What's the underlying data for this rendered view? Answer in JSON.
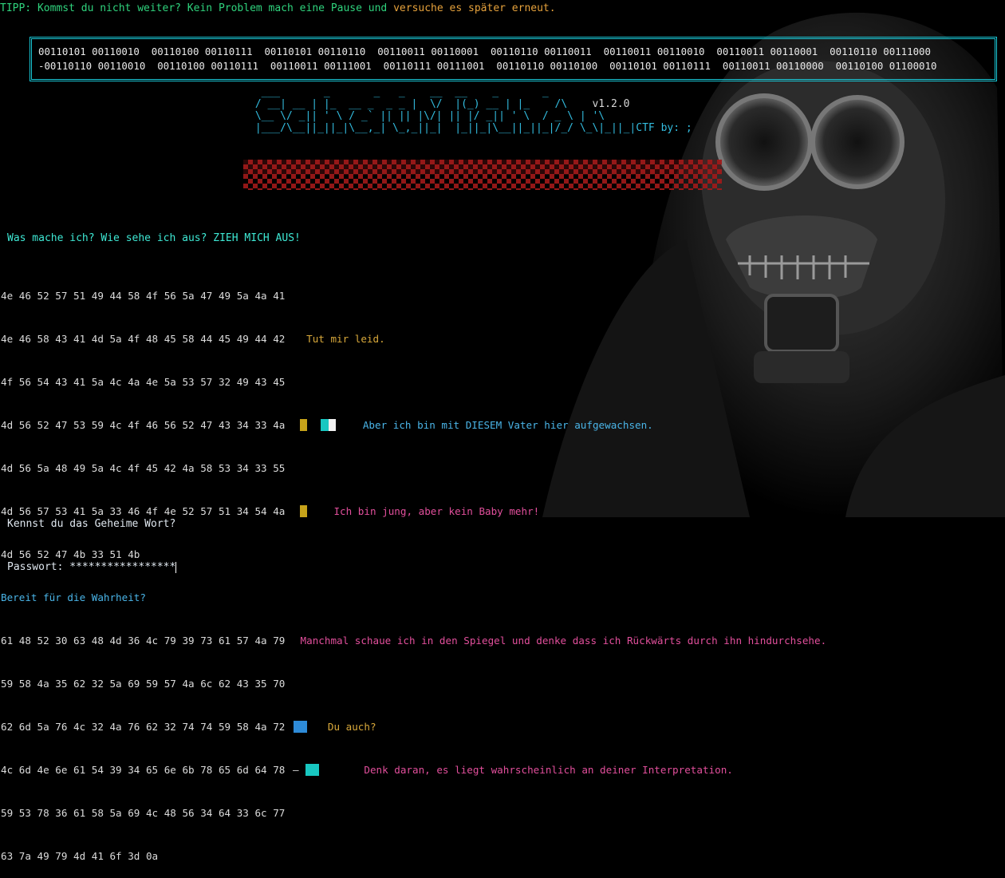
{
  "tip": {
    "label": "TIPP:",
    "part1": " Kommst du nicht weiter? Kein Problem mach eine Pause und ",
    "part2": "versuche es später erneut."
  },
  "binary": {
    "line1": "00110101 00110010  00110100 00110111  00110101 00110110  00110011 00110001  00110110 00110011  00110011 00110010  00110011 00110001  00110110 00111000",
    "line2": "-00110110 00110010  00110100 00110111  00110011 00111001  00110111 00111001  00110110 00110100  00110101 00110111  00110011 00110000  00110100 01100010"
  },
  "banner": {
    "line1": "  ___       _       _   _    __  __    _       _  ",
    "line2": " / __| __ | |_  __ _  _ _ |  \\/  |(_) __ | |_    /\\    ",
    "line3": " \\__ \\/ _|| ' \\ / _` || || |\\/| || |/ _|| ' \\  / _ \\ | '\\",
    "line4": " |___/\\__||_||_|\\__,_| \\_,_||_|  |_||_|\\__||_||_|/_/ \\_\\|_||_|",
    "version": "v1.2.0",
    "ctf": "CTF by: ;"
  },
  "question": "Was mache ich? Wie sehe ich aus? ZIEH MICH AUS!",
  "hexlines": [
    "4e 46 52 57 51 49 44 58 4f 56 5a 47 49 5a 4a 41",
    "4e 46 58 43 41 4d 5a 4f 48 45 58 44 45 49 44 42",
    "4f 56 54 43 41 5a 4c 4a 4e 5a 53 57 32 49 43 45",
    "4d 56 52 47 53 59 4c 4f 46 56 52 47 43 34 33 4a",
    "4d 56 5a 48 49 5a 4c 4f 45 42 4a 58 53 34 33 55",
    "4d 56 57 53 41 5a 33 46 4f 4e 52 57 51 34 54 4a",
    "4d 56 52 47 4b 33 51 4b",
    "61 48 52 30 63 48 4d 36 4c 79 39 73 61 57 4a 79",
    "59 58 4a 35 62 32 5a 69 59 57 4a 6c 62 43 35 70",
    "62 6d 5a 76 4c 32 4a 76 62 32 74 74 59 58 4a 72",
    "4c 6d 4e 6e 61 54 39 34 65 6e 6b 78 65 6d 64 78",
    "59 53 78 36 61 58 5a 69 4c 48 56 34 64 33 6c 77",
    "63 7a 49 79 4d 41 6f 3d 0a"
  ],
  "phrases": {
    "p1": "Tut mir leid.",
    "p2": "Aber ich bin mit DIESEM Vater hier aufgewachsen.",
    "p3": "Ich bin jung, aber kein Baby mehr!",
    "p4": "Bereit für die Wahrheit?",
    "p5": "Manchmal schaue ich in den Spiegel und denke dass ich Rückwärts durch ihn hindurchsehe.",
    "p6": "Du auch?",
    "p7": "Denk daran, es liegt wahrscheinlich an deiner Interpretation."
  },
  "prompt": {
    "question": "Kennst du das Geheime Wort?",
    "label": "Passwort:",
    "value": "*****************"
  },
  "colors": {
    "cyan": "#19c7d6",
    "green": "#2fd37d",
    "orange": "#e6a23c",
    "magenta": "#b52f86",
    "gold": "#c7a31a",
    "blue": "#2e8bd8",
    "red": "#a21a1a"
  }
}
